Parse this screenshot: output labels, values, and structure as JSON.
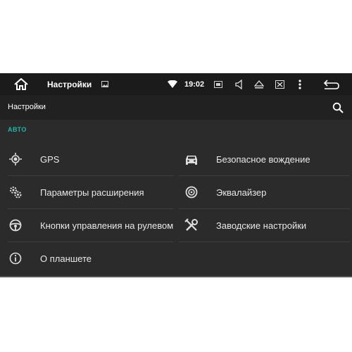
{
  "statusbar": {
    "title": "Настройки",
    "time": "19:02",
    "icons": [
      "home-icon",
      "image-icon",
      "wifi-icon",
      "sd-card-icon",
      "volume-icon",
      "eject-icon",
      "close-box-icon",
      "overflow-menu-icon",
      "back-icon"
    ]
  },
  "toolbar": {
    "title": "Настройки",
    "search_icon": "search-icon"
  },
  "section": {
    "label": "АВТО"
  },
  "items": [
    {
      "label": "GPS",
      "icon": "gps-icon"
    },
    {
      "label": "Безопасное вождение",
      "icon": "car-icon"
    },
    {
      "label": "Параметры расширения",
      "icon": "gears-icon"
    },
    {
      "label": "Эквалайзер",
      "icon": "equalizer-icon"
    },
    {
      "label": "Кнопки управления на рулевом колесе",
      "icon": "steering-wheel-icon"
    },
    {
      "label": "Заводские настройки",
      "icon": "tools-icon"
    },
    {
      "label": "О планшете",
      "icon": "info-icon"
    }
  ],
  "colors": {
    "accent": "#1fb8a6",
    "background": "#2b2b2b",
    "statusbar": "#1b1b1b",
    "toolbar": "#212121"
  }
}
